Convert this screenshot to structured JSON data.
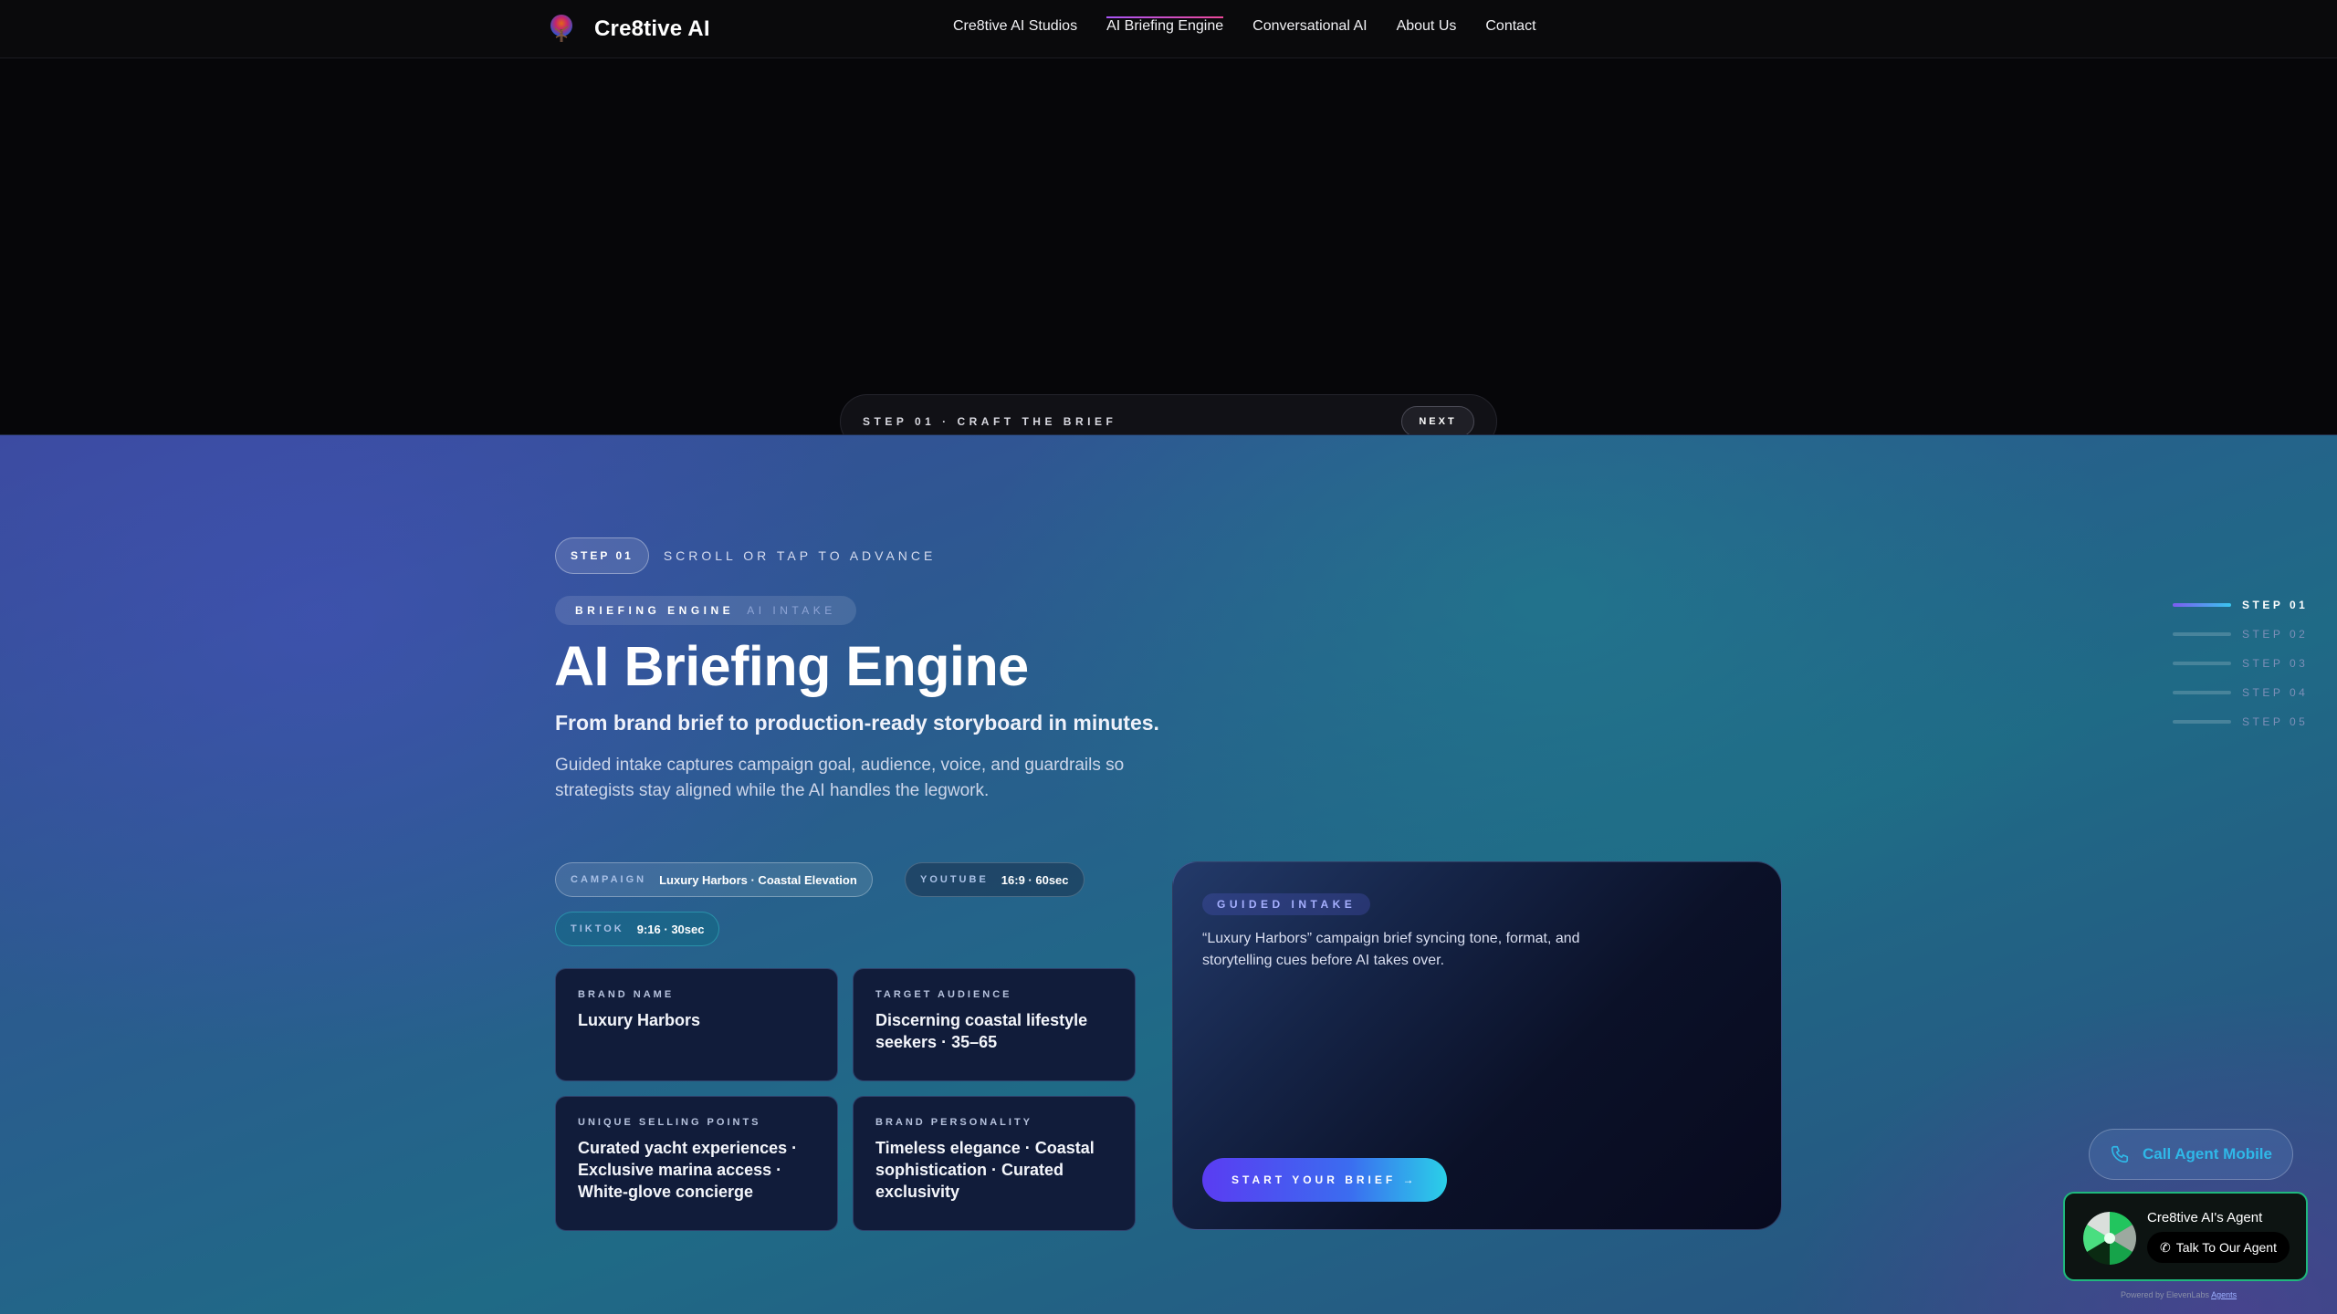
{
  "nav": {
    "brand": "Cre8tive AI",
    "items": [
      {
        "label": "Cre8tive AI Studios"
      },
      {
        "label": "AI Briefing Engine",
        "active": true
      },
      {
        "label": "Conversational AI"
      },
      {
        "label": "About Us"
      },
      {
        "label": "Contact"
      }
    ]
  },
  "hero": {
    "step_label": "STEP 01 · CRAFT THE BRIEF",
    "next_label": "NEXT"
  },
  "main": {
    "step_pill": "STEP 01",
    "step_hint": "SCROLL OR TAP TO ADVANCE",
    "tag_primary": "BRIEFING ENGINE",
    "tag_secondary": "AI INTAKE",
    "title": "AI Briefing Engine",
    "subtitle": "From brand brief to production-ready storyboard in minutes.",
    "description": "Guided intake captures campaign goal, audience, voice, and guardrails so strategists stay aligned while the AI handles the legwork.",
    "chips": {
      "campaign": {
        "key": "CAMPAIGN",
        "value": "Luxury Harbors · Coastal Elevation"
      },
      "youtube": {
        "key": "YOUTUBE",
        "value": "16:9 · 60sec"
      },
      "tiktok": {
        "key": "TIKTOK",
        "value": "9:16 · 30sec"
      }
    },
    "cards": [
      {
        "label": "BRAND NAME",
        "value": "Luxury Harbors"
      },
      {
        "label": "TARGET AUDIENCE",
        "value": "Discerning coastal lifestyle seekers · 35–65"
      },
      {
        "label": "UNIQUE SELLING POINTS",
        "value": "Curated yacht experiences · Exclusive marina access · White-glove concierge"
      },
      {
        "label": "BRAND PERSONALITY",
        "value": "Timeless elegance · Coastal sophistication · Curated exclusivity"
      }
    ],
    "panel": {
      "tag": "GUIDED INTAKE",
      "text": "“Luxury Harbors” campaign brief syncing tone, format, and storytelling cues before AI takes over.",
      "button": "START YOUR BRIEF →"
    }
  },
  "rail": {
    "active_index": 0,
    "steps": [
      "STEP 01",
      "STEP 02",
      "STEP 03",
      "STEP 04",
      "STEP 05"
    ]
  },
  "widget": {
    "call_label": "Call Agent Mobile",
    "agent_title": "Cre8tive AI's Agent",
    "agent_button": "Talk To Our Agent",
    "powered_prefix": "Powered by ElevenLabs",
    "powered_link": "Agents"
  },
  "colors": {
    "accent_purple": "#5a3cf2",
    "accent_cyan": "#2ad0e8",
    "agent_green": "#1fb87d",
    "call_blue": "#2fb8e8"
  },
  "icons": [
    "tree-logo-icon",
    "phone-icon",
    "agent-orb-icon"
  ]
}
